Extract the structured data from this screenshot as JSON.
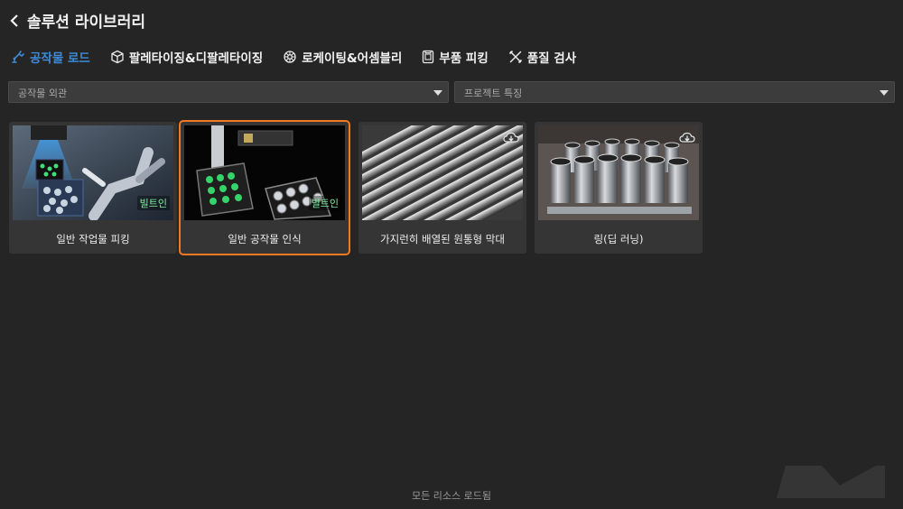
{
  "header": {
    "title": "솔루션 라이브러리",
    "back_icon": "chevron-left-icon"
  },
  "tabs": [
    {
      "label": "공작물 로드",
      "icon": "robot-arm-icon",
      "active": true
    },
    {
      "label": "팔레타이징&디팔레타이징",
      "icon": "box-icon",
      "active": false
    },
    {
      "label": "로케이팅&어셈블리",
      "icon": "gear-icon",
      "active": false
    },
    {
      "label": "부품 피킹",
      "icon": "parts-bin-icon",
      "active": false
    },
    {
      "label": "품질 검사",
      "icon": "tools-icon",
      "active": false
    }
  ],
  "filters": {
    "workpiece": {
      "value": "공작물 외관"
    },
    "project": {
      "value": "프로젝트 특징"
    }
  },
  "cards": [
    {
      "label": "일반 작업물 피킹",
      "badge": "빌트인",
      "selected": false
    },
    {
      "label": "일반 공작물 인식",
      "badge": "빌트인",
      "selected": true
    },
    {
      "label": "가지런히 배열된 원통형 막대",
      "download_icon": "cloud-download-icon",
      "selected": false
    },
    {
      "label": "링(딥 러닝)",
      "download_icon": "cloud-download-icon",
      "selected": false
    }
  ],
  "footer": {
    "status": "모든 리소스 로드됨"
  },
  "colors": {
    "accent": "#3f8ad8",
    "selection": "#ef7a22",
    "badge": "#7ff0a0",
    "background": "#252525"
  }
}
